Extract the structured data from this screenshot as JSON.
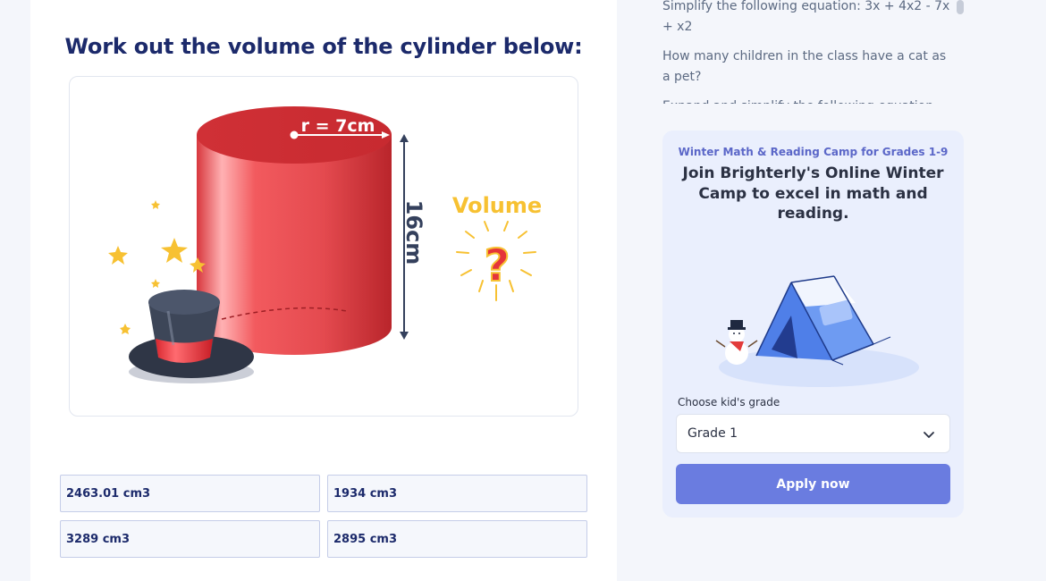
{
  "question": {
    "title": "Work out the volume of the cylinder below:",
    "figure": {
      "radius_label": "r = 7cm",
      "height_label": "16cm",
      "volume_label": "Volume",
      "question_mark": "?"
    }
  },
  "answers": [
    {
      "label": "2463.01 cm3"
    },
    {
      "label": "1934 cm3"
    },
    {
      "label": "3289 cm3"
    },
    {
      "label": "2895 cm3"
    }
  ],
  "related_questions": [
    {
      "text": "Simplify the following equation: 3x + 4x2 - 7x + x2"
    },
    {
      "text": "How many children in the class have a cat as a pet?"
    },
    {
      "text": "Expand and simplify the following equation"
    }
  ],
  "promo": {
    "kicker": "Winter Math & Reading Camp for Grades 1-9",
    "title": "Join Brighterly's Online Winter Camp to excel in math and reading.",
    "grade_label": "Choose kid's grade",
    "grade_value": "Grade 1",
    "apply_label": "Apply now"
  },
  "colors": {
    "title_navy": "#1c2a6b",
    "cylinder_red": "#e8484c",
    "volume_yellow": "#f7c132",
    "apply_button": "#6a7ce0",
    "promo_bg": "#eaeffd"
  }
}
